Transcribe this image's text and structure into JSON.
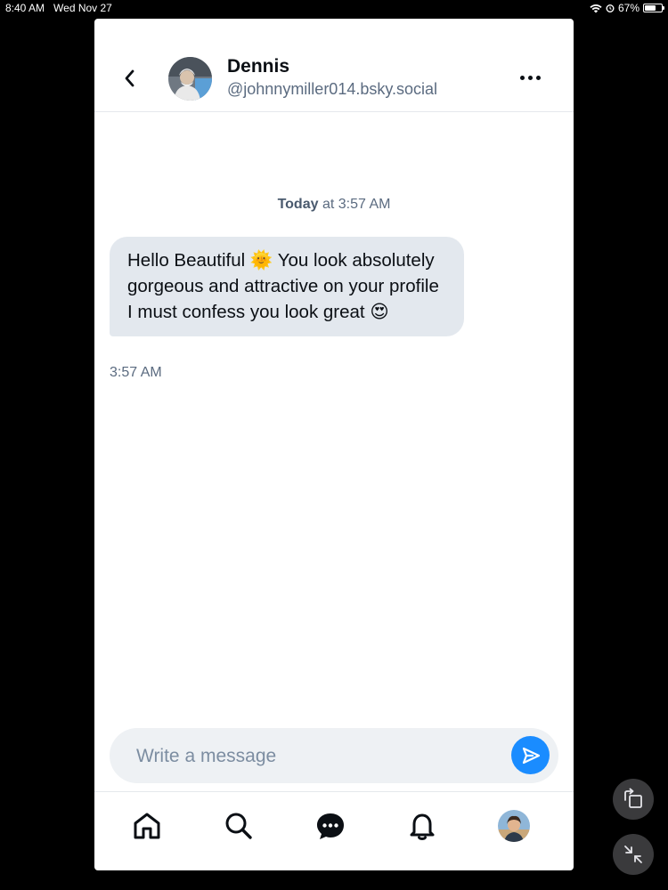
{
  "status_bar": {
    "time": "8:40 AM",
    "date": "Wed Nov 27",
    "battery": "67%",
    "battery_level": 0.67
  },
  "conversation": {
    "name": "Dennis",
    "handle": "@johnnymiller014.bsky.social",
    "date_label_bold": "Today",
    "date_label_rest": " at 3:57 AM"
  },
  "messages": [
    {
      "text": "Hello Beautiful 🌞 You look absolutely gorgeous and attractive on your profile I must confess you look great 😍",
      "time": "3:57 AM"
    }
  ],
  "composer": {
    "placeholder": "Write a message"
  },
  "tabs": [
    "home-icon",
    "search-icon",
    "chat-icon",
    "bell-icon",
    "profile-avatar"
  ],
  "colors": {
    "accent": "#1a8cff",
    "bubble": "#e3e8ee",
    "muted_text": "#5b6b80"
  }
}
